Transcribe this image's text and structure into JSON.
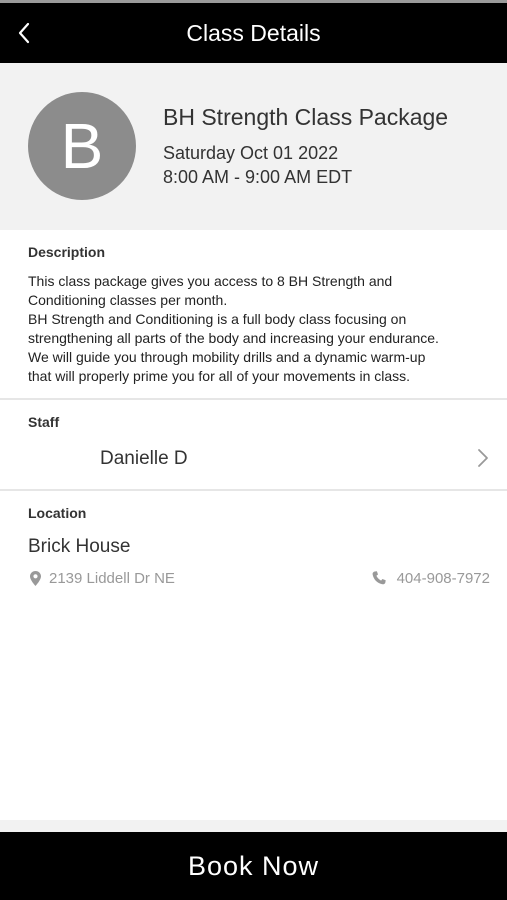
{
  "header": {
    "title": "Class Details",
    "back_icon": "chevron-left-icon"
  },
  "class_info": {
    "avatar_letter": "B",
    "name": "BH Strength Class Package",
    "date": "Saturday Oct 01 2022",
    "time": "8:00 AM - 9:00 AM EDT"
  },
  "description": {
    "label": "Description",
    "lines": [
      "This class package gives you access to 8 BH Strength and",
      "Conditioning classes per month.",
      "BH Strength and Conditioning is a full body class focusing on",
      "strengthening all parts of the body and increasing your endurance.",
      "We will guide you through mobility drills and a dynamic warm-up",
      "that will properly prime you for all of your movements in class."
    ]
  },
  "staff": {
    "label": "Staff",
    "name": "Danielle D",
    "chevron_icon": "chevron-right-icon"
  },
  "location": {
    "label": "Location",
    "name": "Brick House",
    "address": "2139 Liddell Dr NE",
    "address_icon": "map-pin-icon",
    "phone": "404-908-7972",
    "phone_icon": "phone-icon"
  },
  "footer": {
    "book_label": "Book Now"
  },
  "colors": {
    "header_bg": "#000000",
    "hero_bg": "#f2f2f2",
    "avatar_bg": "#8c8c8c",
    "muted_text": "#999999"
  }
}
